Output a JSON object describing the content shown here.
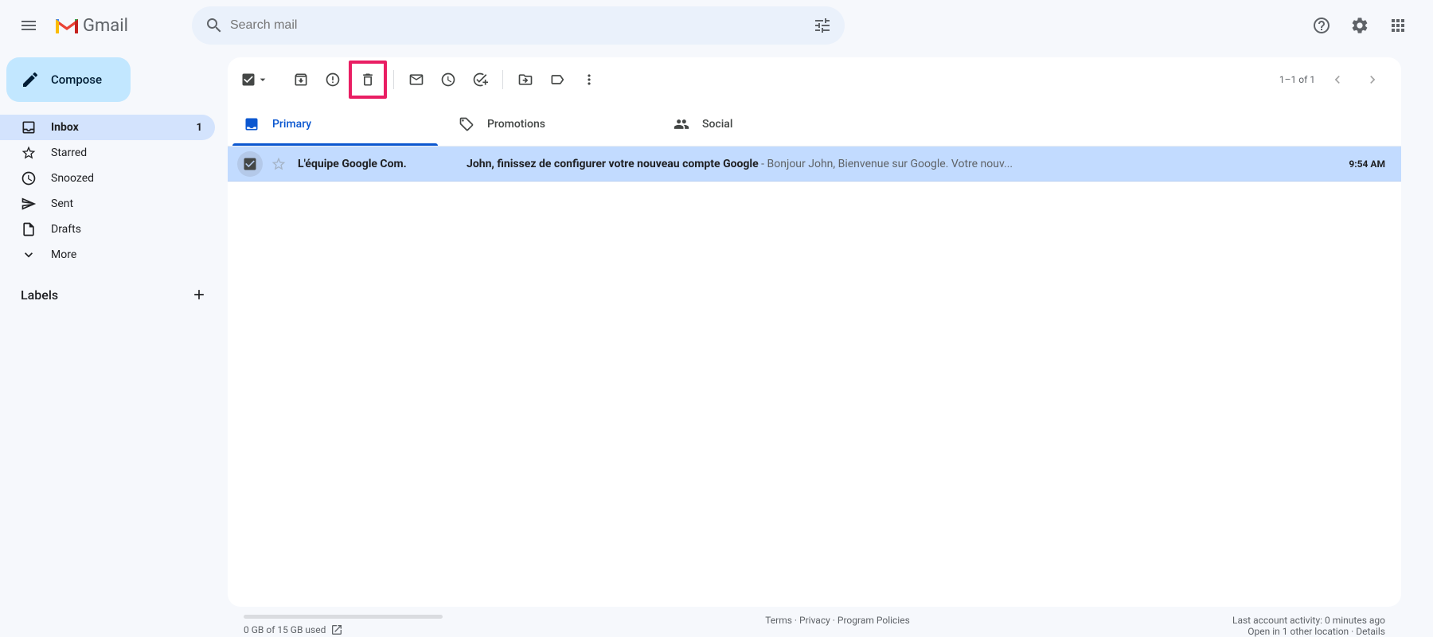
{
  "header": {
    "logo_text": "Gmail",
    "search_placeholder": "Search mail"
  },
  "compose_label": "Compose",
  "nav": {
    "inbox": {
      "label": "Inbox",
      "count": "1"
    },
    "starred": {
      "label": "Starred"
    },
    "snoozed": {
      "label": "Snoozed"
    },
    "sent": {
      "label": "Sent"
    },
    "drafts": {
      "label": "Drafts"
    },
    "more": {
      "label": "More"
    }
  },
  "labels_header": "Labels",
  "toolbar": {
    "page_info": "1–1 of 1"
  },
  "tabs": {
    "primary": "Primary",
    "promotions": "Promotions",
    "social": "Social"
  },
  "emails": [
    {
      "sender": "L'équipe Google Com.",
      "subject": "John, finissez de configurer votre nouveau compte Google",
      "separator": " - ",
      "preview": "Bonjour John, Bienvenue sur Google. Votre nouv...",
      "time": "9:54 AM"
    }
  ],
  "footer": {
    "storage": "0 GB of 15 GB used",
    "terms": "Terms",
    "privacy": "Privacy",
    "policies": "Program Policies",
    "activity": "Last account activity: 0 minutes ago",
    "open_in": "Open in 1 other location",
    "details": "Details"
  }
}
